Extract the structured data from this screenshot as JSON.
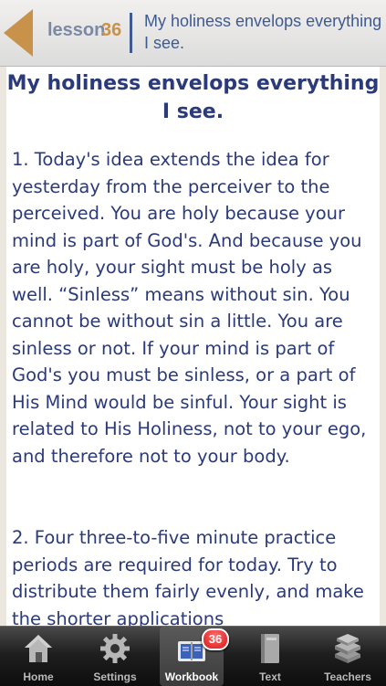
{
  "header": {
    "lesson_label": "lesson",
    "lesson_number": "36",
    "title": "My holiness envelops everything I see."
  },
  "content": {
    "heading": "My holiness envelops everything I see.",
    "paragraphs": [
      "1. Today's idea extends the idea for yesterday from the perceiver to the perceived. You are holy because your mind is part of God's. And because you are holy, your sight must be holy as well. “Sinless” means without sin. You cannot be without sin a little. You are sinless or not. If your mind is part of God's you must be sinless, or a part of His Mind would be sinful. Your sight is related to His Holiness, not to your ego, and therefore not to your body.",
      "2. Four three-to-five minute practice periods are required for today. Try to distribute them fairly evenly, and make the shorter applications"
    ]
  },
  "tabbar": {
    "tabs": [
      {
        "label": "Home",
        "icon": "home-icon"
      },
      {
        "label": "Settings",
        "icon": "gear-icon"
      },
      {
        "label": "Workbook",
        "icon": "workbook-icon",
        "badge": "36",
        "active": true
      },
      {
        "label": "Text",
        "icon": "book-icon"
      },
      {
        "label": "Teachers",
        "icon": "books-stack-icon"
      }
    ]
  },
  "colors": {
    "accent": "#c9924a",
    "text": "#2b3a7a",
    "header_title": "#3e5a90"
  }
}
